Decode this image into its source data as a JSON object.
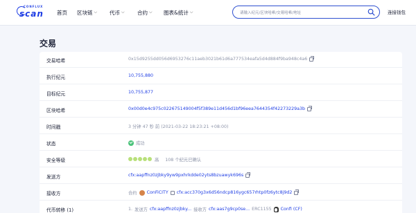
{
  "brand": {
    "small": "CONFLUX",
    "big": "scan"
  },
  "nav": {
    "home": "首页",
    "blockchain": "区块链",
    "tokens": "代币",
    "contracts": "合约",
    "charts": "图表&统计",
    "chevron": "⌵"
  },
  "search": {
    "placeholder": "请输入纪元/区块哈希/交易哈希/地址"
  },
  "wallet": {
    "label": "连接钱包"
  },
  "page": {
    "title": "交易"
  },
  "tx": {
    "hash_label": "交易哈希",
    "hash_value": "0x15d9255dd056d6953276c11aeb3021b61d6a777534eafa5d4d884f9ba948c4a6",
    "exec_epoch_label": "执行纪元",
    "exec_epoch_value": "10,755,880",
    "target_epoch_label": "目标纪元",
    "target_epoch_value": "10,755,877",
    "block_hash_label": "区块哈希",
    "block_hash_value": "0x00d0e4c975c022675149004f5f389e11d456d1bf96eea7644354f42273229a3b",
    "timestamp_label": "时间戳",
    "timestamp_value": "3 分钟 47 秒 前 (2021-03-22 18:23:21 +08:00)",
    "status_label": "状态",
    "status_value": "成功",
    "security_label": "安全等级",
    "security_level": "高",
    "security_detail": "108 个纪元已确认",
    "from_label": "发送方",
    "from_value": "cfx:aapffnz0zjbky9yw9pxhrkdde02yts8bzuawyk696s",
    "to_label": "接收方",
    "to_prefix": "合约",
    "to_name": "ConFiCITY",
    "to_value": "cfx:acc370g3x6d56ndcp816ygc657rhtp0fz6ytc8j9d2",
    "transfer_label": "代币转移 (1)",
    "transfer_index": "1.",
    "transfer_from_label": "发送方",
    "transfer_from": "cfx:aapffnz0zjbky...",
    "transfer_to_label": "接收方",
    "transfer_to": "cfx:aas7g9cp0se...",
    "transfer_standard": "ERC1155",
    "transfer_token": "Confi (CF)"
  },
  "colors": {
    "accent": "#1e3de4",
    "success": "#4cc37b",
    "security": "#b8e07a"
  }
}
